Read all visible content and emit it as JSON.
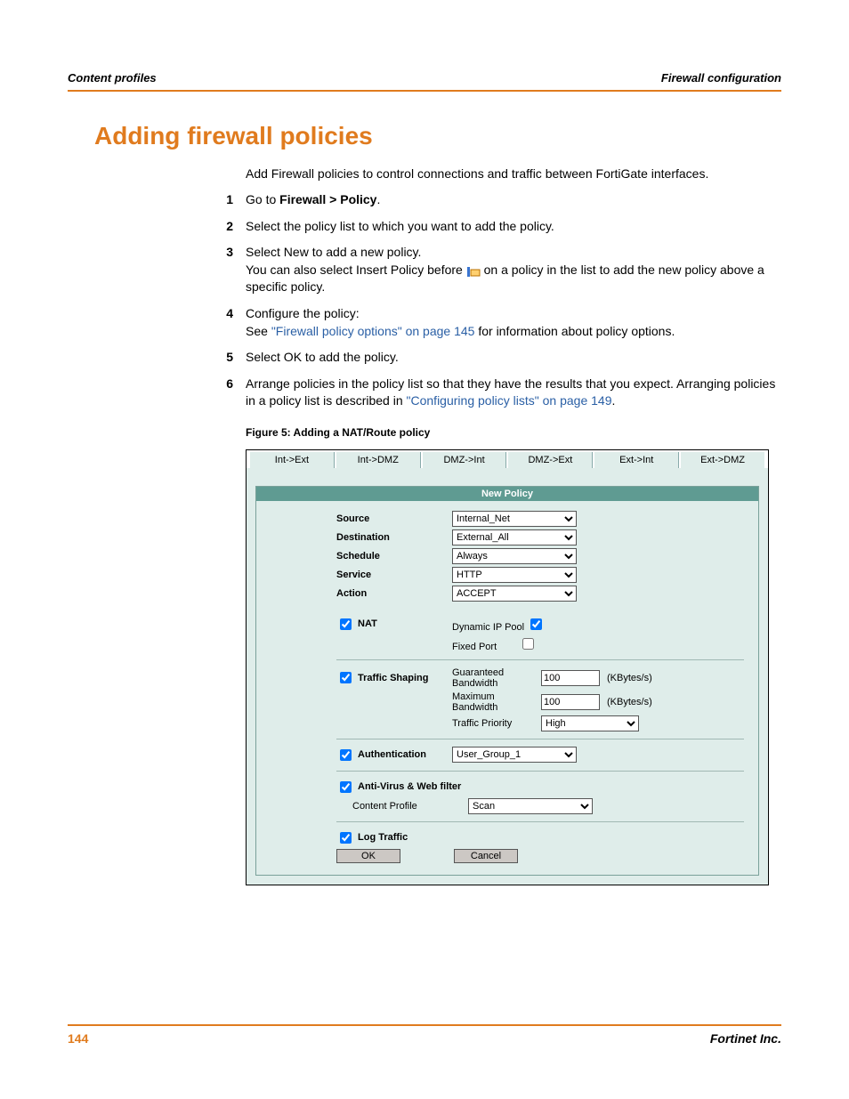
{
  "header": {
    "left": "Content profiles",
    "right": "Firewall configuration"
  },
  "title": "Adding firewall policies",
  "intro": "Add Firewall policies to control connections and traffic between FortiGate interfaces.",
  "steps": {
    "s1a": "Go to ",
    "s1b": "Firewall > Policy",
    "s1c": ".",
    "s2": "Select the policy list to which you want to add the policy.",
    "s3a": "Select New to add a new policy.",
    "s3b": "You can also select Insert Policy before ",
    "s3c": " on a policy in the list to add the new policy above a specific policy.",
    "s4a": "Configure the policy:",
    "s4b": "See ",
    "s4link": "\"Firewall policy options\" on page 145",
    "s4c": " for information about policy options.",
    "s5": "Select OK to add the policy.",
    "s6a": "Arrange policies in the policy list so that they have the results that you expect. Arranging policies in a policy list is described in ",
    "s6link": "\"Configuring policy lists\" on page 149",
    "s6b": "."
  },
  "figcaption": "Figure 5:   Adding a NAT/Route policy",
  "tabs": [
    "Int->Ext",
    "Int->DMZ",
    "DMZ->Int",
    "DMZ->Ext",
    "Ext->Int",
    "Ext->DMZ"
  ],
  "form": {
    "header": "New Policy",
    "source_lbl": "Source",
    "source_val": "Internal_Net",
    "dest_lbl": "Destination",
    "dest_val": "External_All",
    "sched_lbl": "Schedule",
    "sched_val": "Always",
    "service_lbl": "Service",
    "service_val": "HTTP",
    "action_lbl": "Action",
    "action_val": "ACCEPT",
    "nat_lbl": "NAT",
    "dynip_lbl": "Dynamic IP Pool",
    "fixed_lbl": "Fixed Port",
    "ts_lbl": "Traffic Shaping",
    "gbw_lbl": "Guaranteed Bandwidth",
    "gbw_val": "100",
    "gbw_unit": "(KBytes/s)",
    "mbw_lbl": "Maximum Bandwidth",
    "mbw_val": "100",
    "mbw_unit": "(KBytes/s)",
    "tp_lbl": "Traffic Priority",
    "tp_val": "High",
    "auth_lbl": "Authentication",
    "auth_val": "User_Group_1",
    "av_lbl": "Anti-Virus & Web filter",
    "cp_lbl": "Content Profile",
    "cp_val": "Scan",
    "log_lbl": "Log Traffic",
    "ok": "OK",
    "cancel": "Cancel"
  },
  "footer": {
    "page": "144",
    "company": "Fortinet Inc."
  }
}
